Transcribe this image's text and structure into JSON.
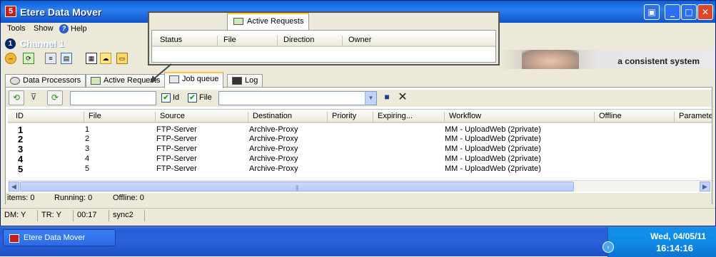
{
  "window": {
    "title": "Etere Data Mover"
  },
  "menu": {
    "items": [
      "Tools",
      "Show",
      "Help"
    ]
  },
  "channel": {
    "number": "1",
    "name": "Channel 1"
  },
  "banner": {
    "slogan": "a consistent system"
  },
  "tabs": [
    {
      "label": "Data Processors",
      "icon": "gears-icon"
    },
    {
      "label": "Active Requests",
      "icon": "requests-icon"
    },
    {
      "label": "Job queue",
      "icon": "queue-icon",
      "active": true
    },
    {
      "label": "Log",
      "icon": "log-icon"
    }
  ],
  "popup": {
    "tab_label": "Active Requests",
    "columns": [
      "Status",
      "File",
      "Direction",
      "Owner"
    ]
  },
  "filter": {
    "search_value": "",
    "id_checkbox": {
      "label": "Id",
      "checked": true
    },
    "file_checkbox": {
      "label": "File",
      "checked": true
    },
    "combo_value": ""
  },
  "grid": {
    "columns": [
      "ID",
      "File",
      "Source",
      "Destination",
      "Priority",
      "Expiring...",
      "Workflow",
      "Offline",
      "Paramete"
    ],
    "rows": [
      {
        "id": "1",
        "file": "1",
        "source": "FTP-Server",
        "destination": "Archive-Proxy",
        "priority": "",
        "expiring": "",
        "workflow": "MM - UploadWeb (2private)",
        "offline": ""
      },
      {
        "id": "2",
        "file": "2",
        "source": "FTP-Server",
        "destination": "Archive-Proxy",
        "priority": "",
        "expiring": "",
        "workflow": "MM - UploadWeb (2private)",
        "offline": ""
      },
      {
        "id": "3",
        "file": "3",
        "source": "FTP-Server",
        "destination": "Archive-Proxy",
        "priority": "",
        "expiring": "",
        "workflow": "MM - UploadWeb (2private)",
        "offline": ""
      },
      {
        "id": "4",
        "file": "4",
        "source": "FTP-Server",
        "destination": "Archive-Proxy",
        "priority": "",
        "expiring": "",
        "workflow": "MM - UploadWeb (2private)",
        "offline": ""
      },
      {
        "id": "5",
        "file": "5",
        "source": "FTP-Server",
        "destination": "Archive-Proxy",
        "priority": "",
        "expiring": "",
        "workflow": "MM - UploadWeb (2private)",
        "offline": ""
      }
    ]
  },
  "counts": {
    "items": "items: 0",
    "running": "Running: 0",
    "offline": "Offline: 0"
  },
  "statusbar": {
    "dm": "DM: Y",
    "tr": "TR: Y",
    "time": "00:17",
    "sync": "sync2"
  },
  "taskbar": {
    "button_label": "Etere Data Mover",
    "date": "Wed, 04/05/11",
    "time": "16:14:16"
  },
  "colors": {
    "titlebar": "#0a5fd8",
    "taskbar": "#245edb",
    "tray": "#0f8be6",
    "tab_highlight": "#ffc83c"
  }
}
